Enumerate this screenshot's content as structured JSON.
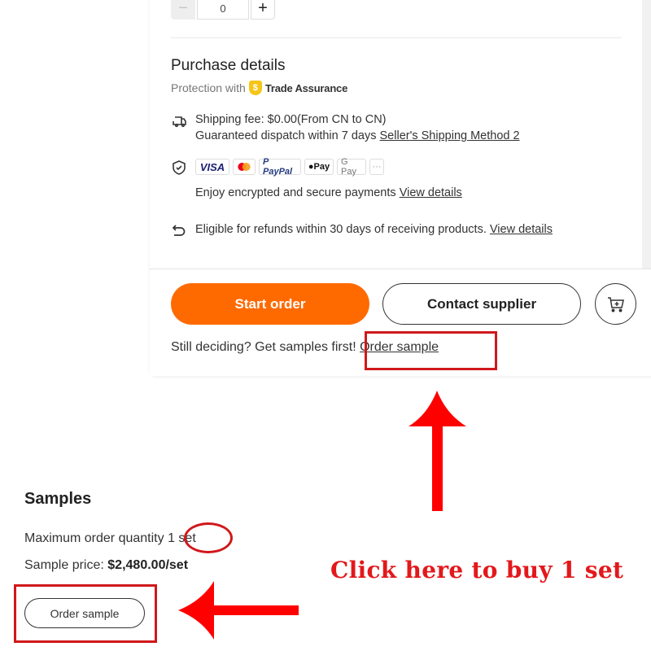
{
  "quantity": {
    "value": "0",
    "minus_label": "−",
    "plus_label": "+"
  },
  "purchase": {
    "title": "Purchase details",
    "protection_prefix": "Protection with",
    "trade_assurance_label": "Trade Assurance",
    "trade_assurance_icon": "$",
    "shipping": {
      "icon": "truck-icon",
      "line1": "Shipping fee: $0.00(From CN to CN)",
      "line2_prefix": "Guaranteed dispatch within 7 days",
      "method_link": "Seller's Shipping Method 2"
    },
    "payments": {
      "icon": "shield-check-icon",
      "methods": [
        "VISA",
        "Mastercard",
        "PayPal",
        "Apple Pay",
        "G Pay",
        "..."
      ],
      "method_labels": {
        "visa": "VISA",
        "paypal": "P PayPal",
        "apple": "Pay",
        "gpay": "G Pay",
        "more": "···"
      },
      "note_prefix": "Enjoy encrypted and secure payments",
      "details_link": "View details"
    },
    "refund": {
      "icon": "return-arrow-icon",
      "text": "Eligible for refunds within 30 days of receiving products.",
      "details_link": "View details"
    }
  },
  "actions": {
    "start_order": "Start order",
    "contact_supplier": "Contact supplier",
    "cart_icon": "add-to-cart-icon",
    "still_deciding": "Still deciding? Get samples first!",
    "order_sample_link": "Order sample"
  },
  "samples": {
    "title": "Samples",
    "max_qty_label": "Maximum order quantity",
    "max_qty_value": "1 set",
    "price_label": "Sample price:",
    "price_value": "$2,480.00/set",
    "order_button": "Order sample"
  },
  "annotation": {
    "text": "Click here to buy 1 set",
    "color": "#e3181b"
  },
  "colors": {
    "primary": "#ff6a00",
    "annotation_red": "#d0181b",
    "text": "#333333"
  }
}
